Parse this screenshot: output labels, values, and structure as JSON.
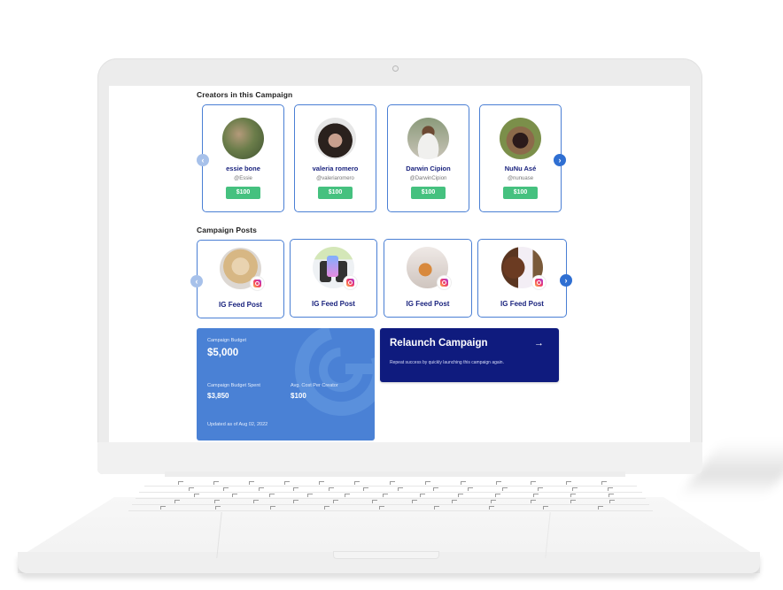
{
  "creators_section": {
    "title": "Creators in this Campaign",
    "prev_icon": "chevron-left-icon",
    "next_icon": "chevron-right-icon",
    "creators": [
      {
        "name": "essie bone",
        "handle": "@Essie",
        "price": "$100"
      },
      {
        "name": "valeria romero",
        "handle": "@valeriaromero",
        "price": "$100"
      },
      {
        "name": "Darwin Cipion",
        "handle": "@DarwinCipion",
        "price": "$100"
      },
      {
        "name": "NuNu Asé",
        "handle": "@nunuase",
        "price": "$100"
      }
    ]
  },
  "posts_section": {
    "title": "Campaign Posts",
    "posts": [
      {
        "label": "IG Feed Post",
        "platform_icon": "instagram-icon"
      },
      {
        "label": "IG Feed Post",
        "platform_icon": "instagram-icon"
      },
      {
        "label": "IG Feed Post",
        "platform_icon": "instagram-icon"
      },
      {
        "label": "IG Feed Post",
        "platform_icon": "instagram-icon"
      }
    ]
  },
  "budget": {
    "budget_label": "Campaign Budget",
    "budget_value": "$5,000",
    "spent_label": "Campaign Budget Spent",
    "spent_value": "$3,850",
    "avg_label": "Avg. Cost Per Creator",
    "avg_value": "$100",
    "updated": "Updated as of Aug 02, 2022",
    "accent_color": "#4a81d5"
  },
  "relaunch": {
    "title": "Relaunch Campaign",
    "arrow": "→",
    "description": "Repeat success by quickly launching this campaign again.",
    "color": "#0f1b7e"
  },
  "nav": {
    "prev": "‹",
    "next": "›"
  }
}
